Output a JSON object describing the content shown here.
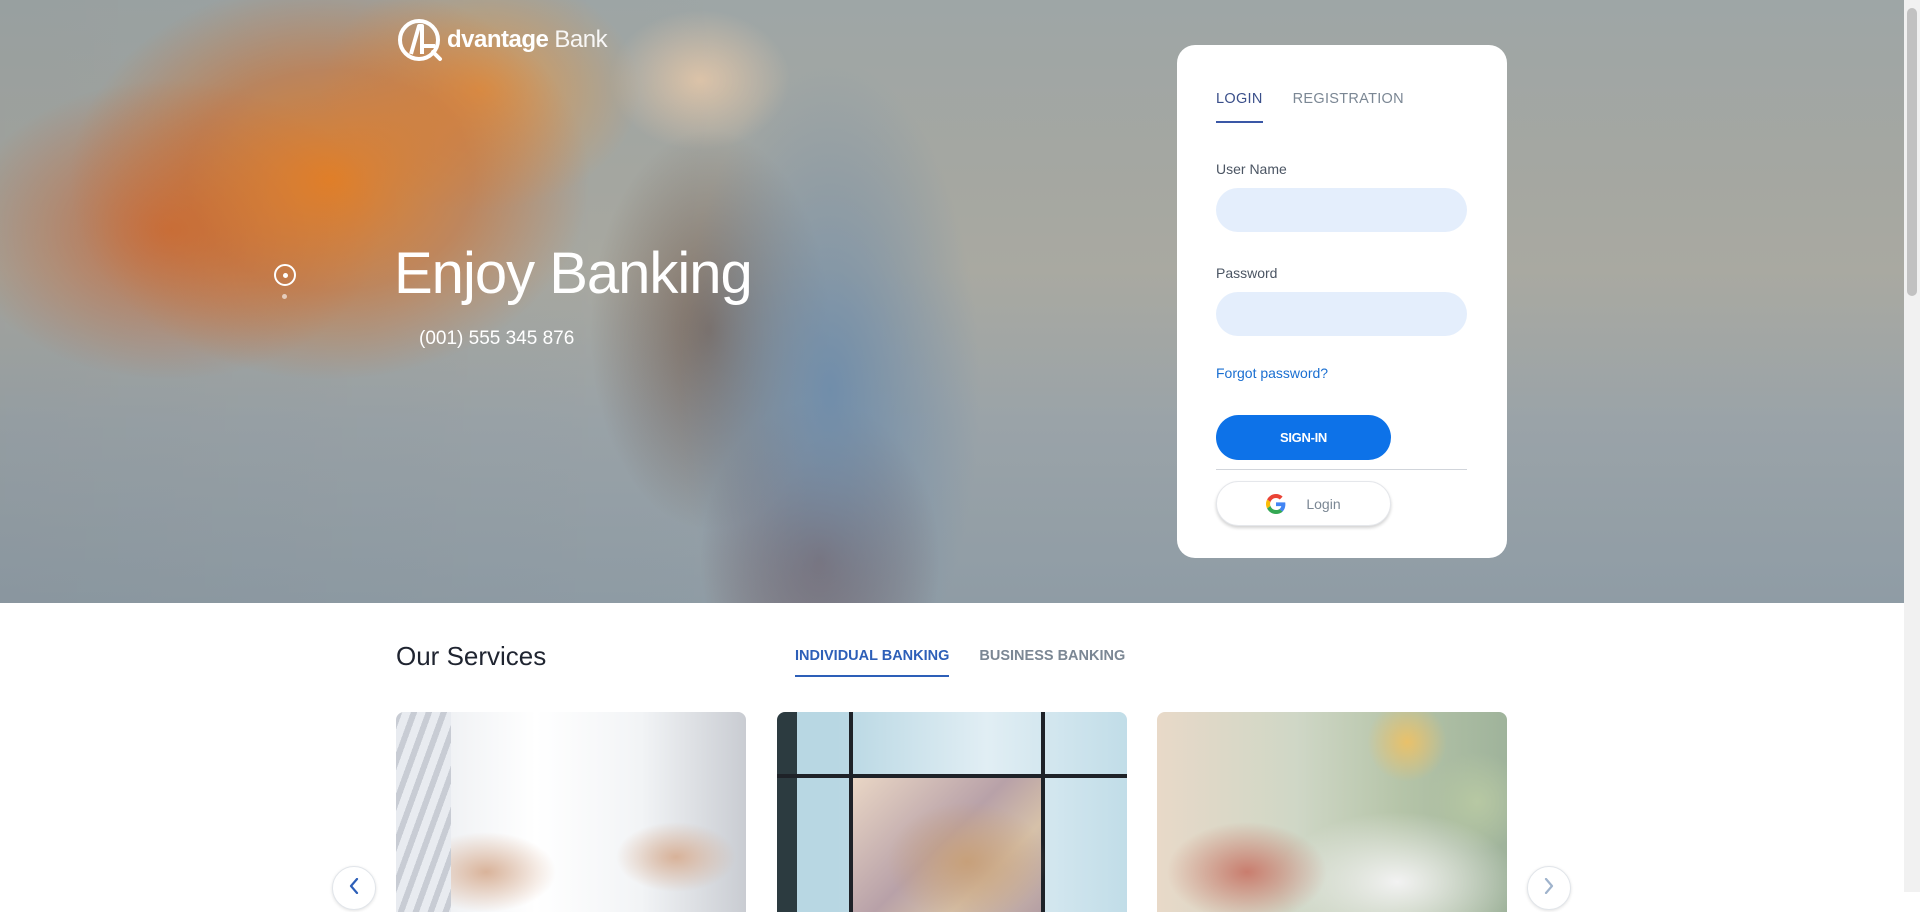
{
  "brand": {
    "logo_main": "dvantage",
    "logo_sub": "Bank"
  },
  "hero": {
    "title": "Enjoy Banking",
    "phone": "(001) 555 345 876",
    "slider_dots": [
      "active",
      "inactive"
    ]
  },
  "login": {
    "tabs": [
      {
        "label": "LOGIN",
        "active": true
      },
      {
        "label": "REGISTRATION",
        "active": false
      }
    ],
    "username_label": "User Name",
    "username_value": "",
    "password_label": "Password",
    "password_value": "",
    "forgot_label": "Forgot password?",
    "signin_label": "SIGN-IN",
    "google_label": "Login"
  },
  "services": {
    "title": "Our Services",
    "tabs": [
      {
        "label": "INDIVIDUAL BANKING",
        "active": true
      },
      {
        "label": "BUSINESS BANKING",
        "active": false
      }
    ],
    "cards": [
      "business-meeting-photo",
      "laptop-desk-photo",
      "documents-hands-photo"
    ]
  },
  "colors": {
    "primary": "#0d72e8",
    "tab_active": "#3a57a6",
    "input_bg": "#e4eefc",
    "link": "#1a6fd1"
  },
  "icons": {
    "prev": "chevron-left-icon",
    "next": "chevron-right-icon",
    "google": "google-icon"
  }
}
